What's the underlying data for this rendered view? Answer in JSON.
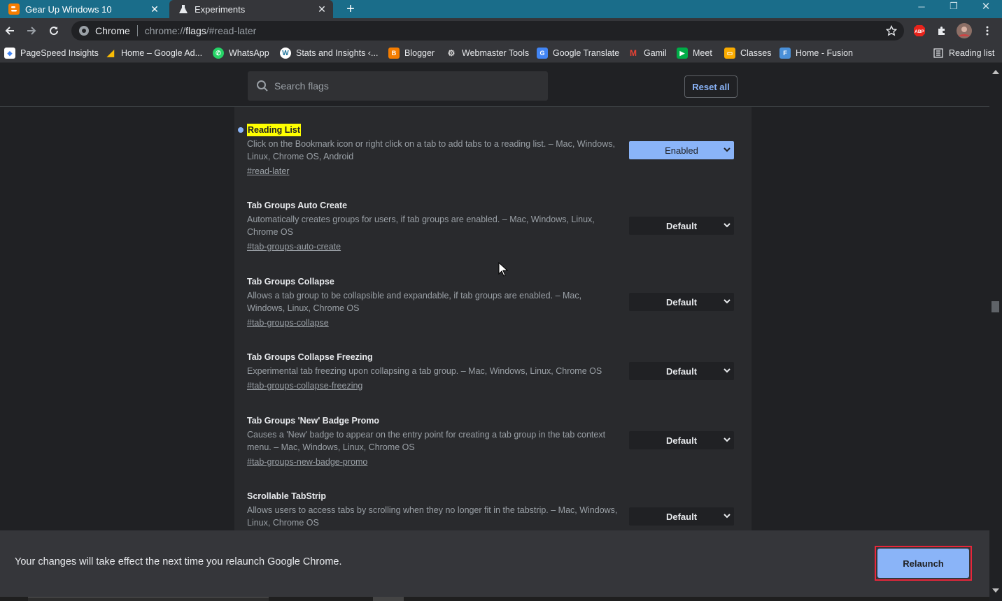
{
  "tabs": [
    {
      "title": "Gear Up Windows 10",
      "icon": "blogger-icon",
      "color": "#f57d00"
    },
    {
      "title": "Experiments",
      "icon": "flask-icon"
    }
  ],
  "toolbar": {
    "site_label": "Chrome",
    "url_prefix": "chrome://",
    "url_host": "flags",
    "url_rest": "/#read-later",
    "abp_label": "ABP"
  },
  "bookmarks": [
    {
      "label": "PageSpeed Insights",
      "icon": "pagespeed-icon",
      "color": "#ffffff"
    },
    {
      "label": "Home – Google Ad...",
      "icon": "google-ads-icon",
      "color": "#fbbc04"
    },
    {
      "label": "WhatsApp",
      "icon": "whatsapp-icon",
      "color": "#25d366"
    },
    {
      "label": "Stats and Insights ‹...",
      "icon": "wordpress-icon",
      "color": "#ffffff"
    },
    {
      "label": "Blogger",
      "icon": "blogger-icon",
      "color": "#f57d00"
    },
    {
      "label": "Webmaster Tools",
      "icon": "webmaster-icon",
      "color": "#d9d9d9"
    },
    {
      "label": "Google Translate",
      "icon": "translate-icon",
      "color": "#4285f4"
    },
    {
      "label": "Gamil",
      "icon": "gmail-icon",
      "color": "#ea4335"
    },
    {
      "label": "Meet",
      "icon": "meet-icon",
      "color": "#00ac47"
    },
    {
      "label": "Classes",
      "icon": "classroom-icon",
      "color": "#f9ab00"
    },
    {
      "label": "Home - Fusion",
      "icon": "fusion-icon",
      "color": "#4a90d9"
    }
  ],
  "reading_list_label": "Reading list",
  "search": {
    "placeholder": "Search flags"
  },
  "reset_label": "Reset all",
  "flags": [
    {
      "name": "Reading List",
      "description": "Click on the Bookmark icon or right click on a tab to add tabs to a reading list. – Mac, Windows, Linux, Chrome OS, Android",
      "link": "#read-later",
      "value": "Enabled",
      "modified": true
    },
    {
      "name": "Tab Groups Auto Create",
      "description": "Automatically creates groups for users, if tab groups are enabled. – Mac, Windows, Linux, Chrome OS",
      "link": "#tab-groups-auto-create",
      "value": "Default"
    },
    {
      "name": "Tab Groups Collapse",
      "description": "Allows a tab group to be collapsible and expandable, if tab groups are enabled. – Mac, Windows, Linux, Chrome OS",
      "link": "#tab-groups-collapse",
      "value": "Default"
    },
    {
      "name": "Tab Groups Collapse Freezing",
      "description": "Experimental tab freezing upon collapsing a tab group. – Mac, Windows, Linux, Chrome OS",
      "link": "#tab-groups-collapse-freezing",
      "value": "Default"
    },
    {
      "name": "Tab Groups 'New' Badge Promo",
      "description": "Causes a 'New' badge to appear on the entry point for creating a tab group in the tab context menu. – Mac, Windows, Linux, Chrome OS",
      "link": "#tab-groups-new-badge-promo",
      "value": "Default"
    },
    {
      "name": "Scrollable TabStrip",
      "description": "Allows users to access tabs by scrolling when they no longer fit in the tabstrip. – Mac, Windows, Linux, Chrome OS",
      "link": "",
      "value": "Default"
    }
  ],
  "relaunch": {
    "message": "Your changes will take effect the next time you relaunch Google Chrome.",
    "button": "Relaunch"
  }
}
